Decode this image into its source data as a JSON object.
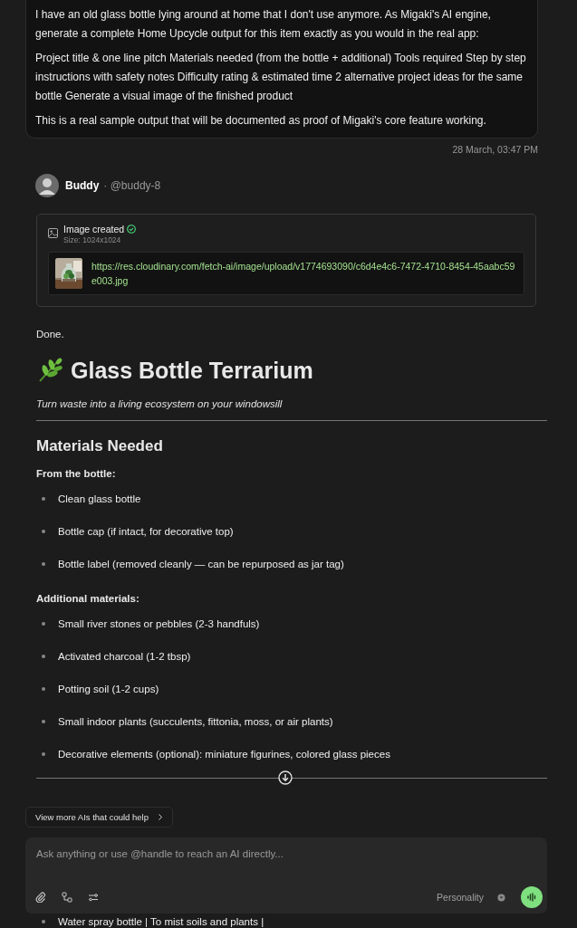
{
  "user_message": {
    "paragraphs": [
      "I have an old glass bottle lying around at home that I don't use anymore. As Migaki's AI engine, generate a complete Home Upcycle output for this item exactly as you would in the real app:",
      "Project title & one line pitch Materials needed (from the bottle + additional) Tools required Step by step instructions with safety notes Difficulty rating & estimated time 2 alternative project ideas for the same bottle Generate a visual image of the finished product",
      "This is a real sample output that will be documented as proof of Migaki's core feature working."
    ],
    "timestamp": "28 March, 03:47 PM"
  },
  "assistant": {
    "name": "Buddy",
    "handle": "· @buddy-8",
    "image_card": {
      "title": "Image created",
      "success": true,
      "size": "Size: 1024x1024",
      "url": "https://res.cloudinary.com/fetch-ai/image/upload/v1774693090/c6d4e4c6-7472-4710-8454-45aabc59e003.jpg"
    },
    "done_text": "Done.",
    "heading": "Glass Bottle Terrarium",
    "tagline": "Turn waste into a living ecosystem on your windowsill",
    "section_title": "Materials Needed",
    "groups": [
      {
        "label": "From the bottle:",
        "items": [
          "Clean glass bottle",
          "Bottle cap (if intact, for decorative top)",
          "Bottle label (removed cleanly — can be repurposed as jar tag)"
        ]
      },
      {
        "label": "Additional materials:",
        "items": [
          "Small river stones or pebbles (2-3 handfuls)",
          "Activated charcoal (1-2 tbsp)",
          "Potting soil (1-2 cups)",
          "Small indoor plants (succulents, fittonia, moss, or air plants)",
          "Decorative elements (optional): miniature figurines, colored glass pieces"
        ]
      }
    ]
  },
  "view_more_button": "View more AIs that could help",
  "composer": {
    "placeholder": "Ask anything or use @handle to reach an AI directly...",
    "personality": "Personality"
  },
  "peeking_item": "Water spray bottle | To mist soils and plants |"
}
